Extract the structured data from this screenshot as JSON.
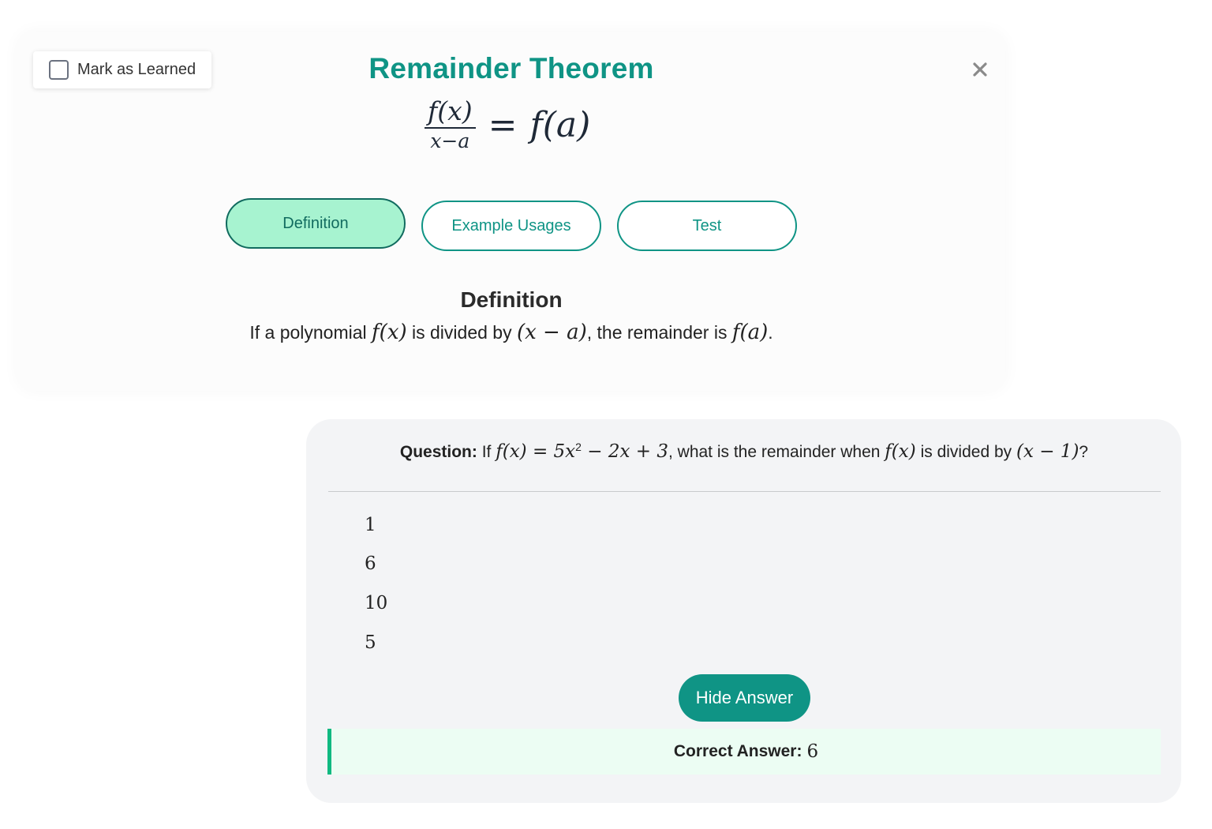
{
  "mark_as_learned": {
    "label": "Mark as Learned",
    "checked": false
  },
  "header": {
    "title": "Remainder Theorem",
    "close_icon": "close-x-icon"
  },
  "formula": {
    "numerator": "f(x)",
    "denominator": "x−a",
    "equals": "=",
    "rhs": "f(a)"
  },
  "tabs": [
    {
      "label": "Definition",
      "active": true
    },
    {
      "label": "Example Usages",
      "active": false
    },
    {
      "label": "Test",
      "active": false
    }
  ],
  "definition": {
    "heading": "Definition",
    "text_1": "If a polynomial ",
    "math_1": "f(x)",
    "text_2": " is divided by ",
    "math_2": "(x − a)",
    "text_3": ", the remainder is ",
    "math_3": "f(a)",
    "text_4": "."
  },
  "question": {
    "label": "Question:",
    "text_1": " If ",
    "math_1a": "f(x) = 5x",
    "math_1sup": "2",
    "math_1b": " − 2x + 3",
    "text_2": ", what is the remainder when ",
    "math_2": "f(x)",
    "text_3": " is divided by ",
    "math_3": "(x − 1)",
    "text_4": "?"
  },
  "options": [
    "1",
    "6",
    "10",
    "5"
  ],
  "hide_answer_label": "Hide Answer",
  "answer": {
    "label": "Correct Answer:",
    "value": "6"
  },
  "colors": {
    "accent": "#0f9485",
    "active_tab_bg": "#a7f3d0",
    "answer_bg": "#ecfdf3",
    "answer_border": "#10b981"
  }
}
